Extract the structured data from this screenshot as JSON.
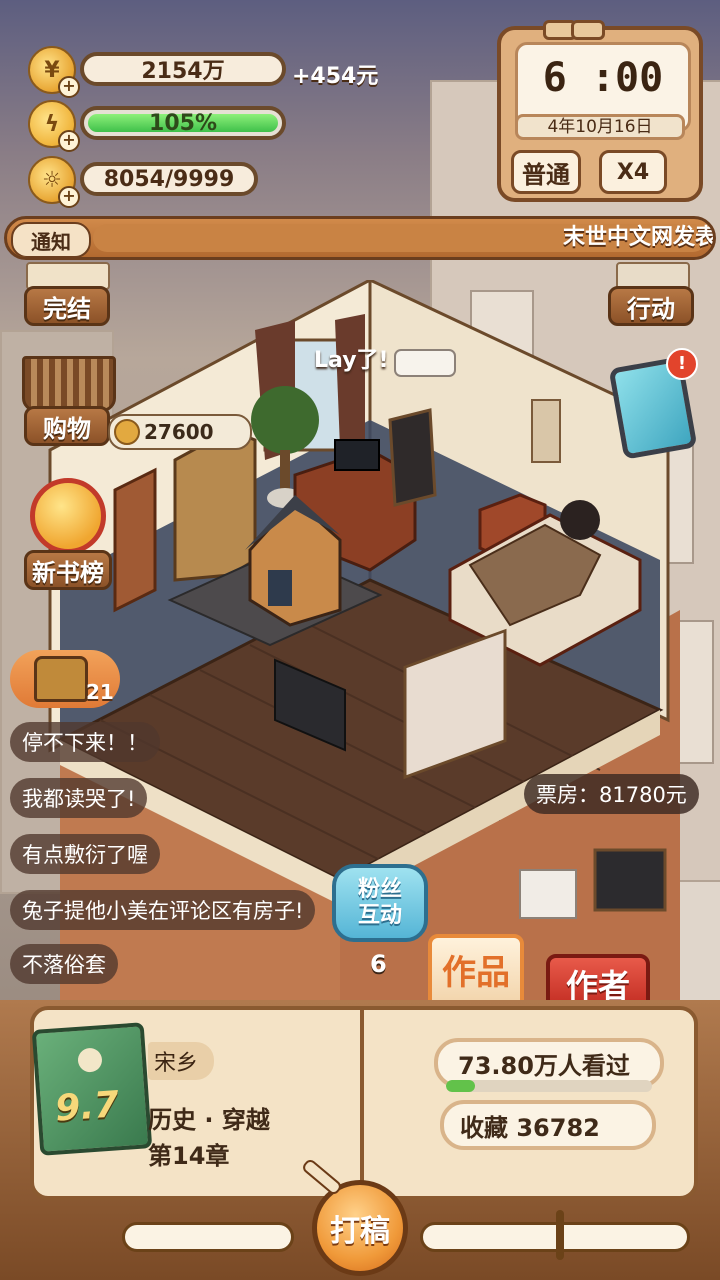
{
  "resources": {
    "coins": {
      "value": "2154万",
      "income": "+454元"
    },
    "energy": {
      "value": "105%",
      "fill": 1.0
    },
    "ideas": {
      "value": "8054/9999"
    }
  },
  "clock": {
    "time": "6 :00",
    "date": "4年10月16日",
    "mode": "普通",
    "speed": "X4"
  },
  "notice": {
    "label": "通知",
    "text": "末世中文网发表"
  },
  "left_menu": {
    "finish": "完结",
    "shop": "购物",
    "coin_balance": "27600",
    "ranking": "新书榜"
  },
  "right_menu": {
    "action": "行动"
  },
  "room": {
    "speech": "Lay了!",
    "chest_count": "21"
  },
  "chat_messages": [
    "停不下来！！",
    "我都读哭了!",
    "有点敷衍了喔",
    "兔子提他小美在评论区有房子!",
    "不落俗套"
  ],
  "box_office": "票房：81780元",
  "fan_interaction": {
    "label": "粉丝互动",
    "count": "6"
  },
  "tabs": {
    "works": "作品",
    "author": "作者"
  },
  "book": {
    "score": "9.7",
    "author": "宋乡",
    "genre": "历史 · 穿越",
    "chapter": "第14章",
    "viewers": "73.80万人看过",
    "viewers_progress": 0.14,
    "favorites": "收藏 36782"
  },
  "write_button": "打稿",
  "colors": {
    "accent": "#e8902f",
    "wood": "#8a5a30",
    "energy": "#4fcf52"
  }
}
